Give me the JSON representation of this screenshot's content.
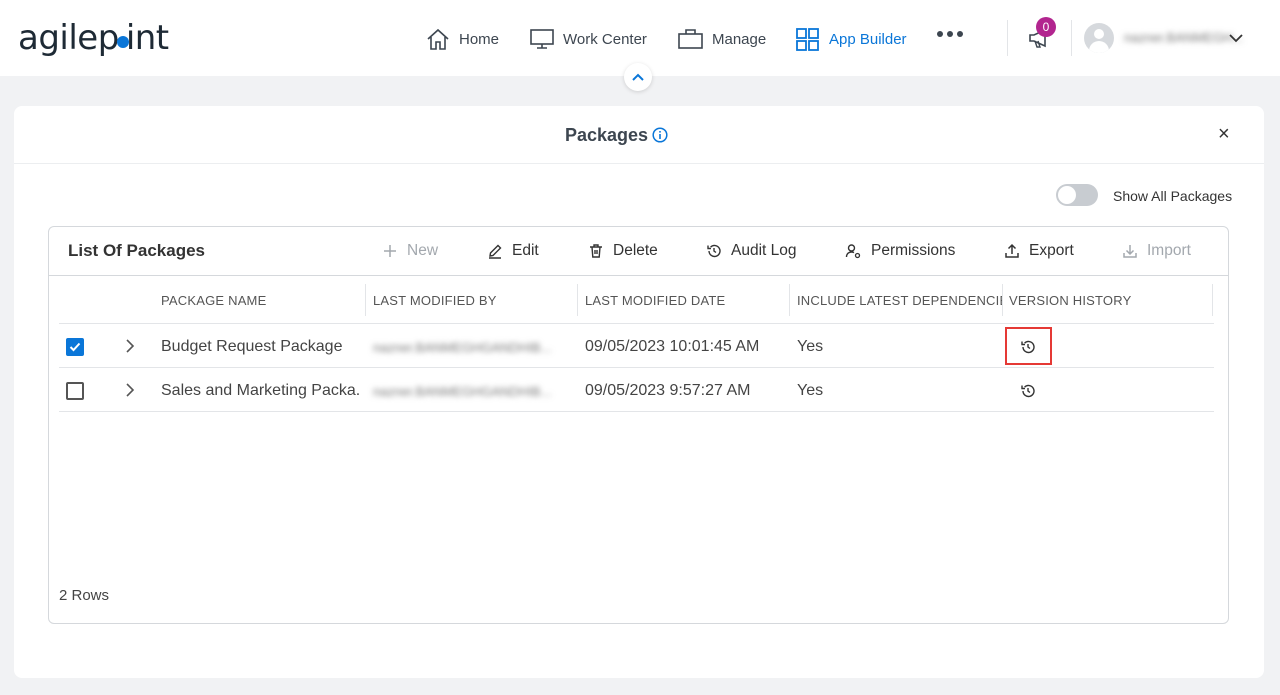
{
  "brand": {
    "logo_pre": "agilep",
    "logo_post": "int"
  },
  "nav": {
    "home": "Home",
    "work_center": "Work Center",
    "manage": "Manage",
    "app_builder": "App Builder",
    "notification_count": "0",
    "username": "nazner.BANMEGH..."
  },
  "panel": {
    "title": "Packages",
    "close": "×",
    "toggle_label": "Show All Packages"
  },
  "card": {
    "title": "List Of Packages",
    "toolbar": {
      "new": "New",
      "edit": "Edit",
      "delete": "Delete",
      "audit_log": "Audit Log",
      "permissions": "Permissions",
      "export": "Export",
      "import": "Import"
    },
    "columns": [
      "PACKAGE NAME",
      "LAST MODIFIED BY",
      "LAST MODIFIED DATE",
      "INCLUDE LATEST DEPENDENCIES",
      "VERSION HISTORY"
    ],
    "rows": [
      {
        "checked": true,
        "name": "Budget Request Package",
        "modified_by": "nazner.BANMEGHGANDHIB...",
        "date": "09/05/2023 10:01:45 AM",
        "deps": "Yes"
      },
      {
        "checked": false,
        "name": "Sales and Marketing Packa...",
        "modified_by": "nazner.BANMEGHGANDHIB...",
        "date": "09/05/2023 9:57:27 AM",
        "deps": "Yes"
      }
    ],
    "row_count": "2 Rows"
  },
  "colors": {
    "accent": "#0a76d8",
    "badge": "#b2258f",
    "highlight": "#e53935"
  }
}
